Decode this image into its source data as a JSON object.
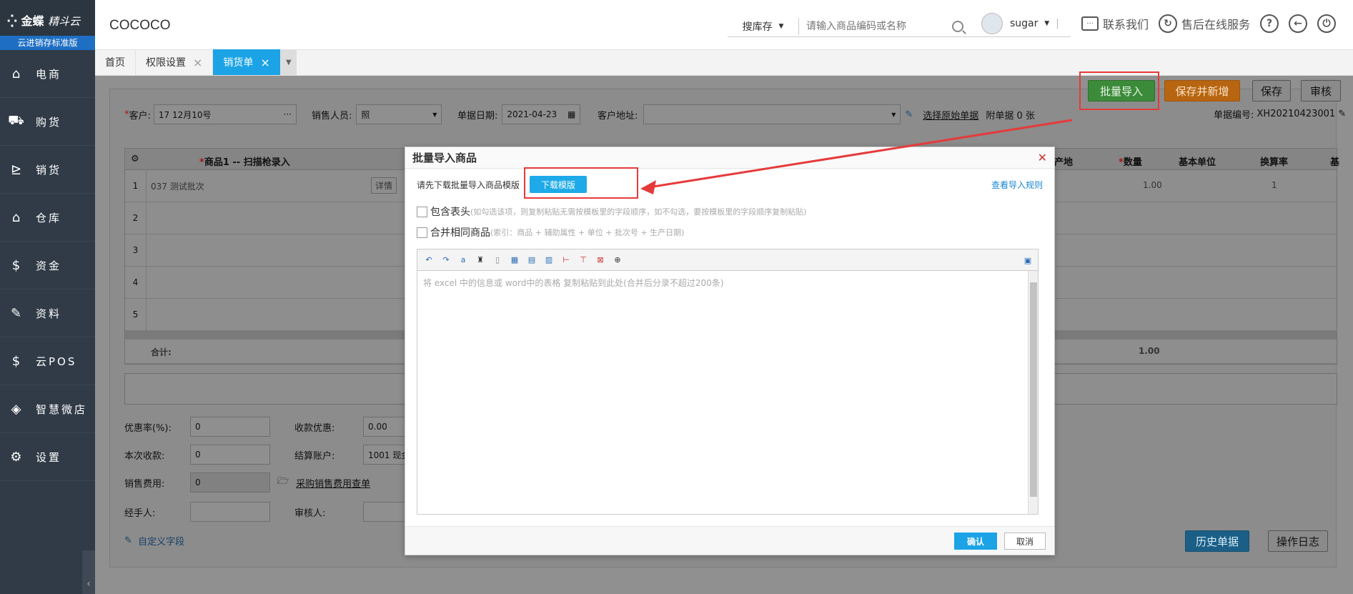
{
  "sidebar": {
    "brand": "金蝶",
    "brand_sub": "精斗云",
    "edition": "云进销存标准版",
    "items": [
      {
        "label": "电商",
        "icon": "store-icon"
      },
      {
        "label": "购货",
        "icon": "cart-icon"
      },
      {
        "label": "销货",
        "icon": "shipping-icon"
      },
      {
        "label": "仓库",
        "icon": "warehouse-icon"
      },
      {
        "label": "资金",
        "icon": "dollar-icon"
      },
      {
        "label": "资料",
        "icon": "pencil-icon"
      },
      {
        "label": "云POS",
        "icon": "pos-icon"
      },
      {
        "label": "智慧微店",
        "icon": "shop-icon"
      },
      {
        "label": "设置",
        "icon": "gear-icon"
      }
    ]
  },
  "topbar": {
    "company": "COCOCO",
    "search_scope": "搜库存",
    "search_placeholder": "请输入商品编码或名称",
    "username": "sugar",
    "contact": "联系我们",
    "service": "售后在线服务",
    "help": "?",
    "back": "←",
    "power": "⏻"
  },
  "tabs": [
    {
      "label": "首页",
      "closable": false
    },
    {
      "label": "权限设置",
      "closable": true
    },
    {
      "label": "销货单",
      "closable": true,
      "active": true
    }
  ],
  "toolbar": {
    "batch_import": "批量导入",
    "save_new": "保存并新增",
    "save": "保存",
    "audit": "审核"
  },
  "form": {
    "customer_label": "客户:",
    "customer_value": "17 12月10号",
    "sales_label": "销售人员:",
    "sales_value": "照",
    "date_label": "单据日期:",
    "date_value": "2021-04-23",
    "address_label": "客户地址:",
    "address_value": "",
    "select_original": "选择原始单据",
    "attach": "附单据 0 张",
    "docno_label": "单据编号:",
    "docno_value": "XH20210423001"
  },
  "grid": {
    "col_product": "商品1 -- 扫描枪录入",
    "col_origin": "产地",
    "col_qty": "数量",
    "col_unit": "基本单位",
    "col_rate": "换算率",
    "col_more": "基",
    "rows": [
      {
        "num": "1",
        "product": "037 测试批次",
        "detail": "详情",
        "qty": "1.00",
        "rate": "1"
      },
      {
        "num": "2"
      },
      {
        "num": "3"
      },
      {
        "num": "4"
      },
      {
        "num": "5"
      }
    ],
    "total_label": "合计:",
    "total_qty": "1.00"
  },
  "bottom_form": {
    "discount_rate_label": "优惠率(%):",
    "discount_rate_value": "0",
    "collect_discount_label": "收款优惠:",
    "collect_discount_value": "0.00",
    "this_collect_label": "本次收款:",
    "this_collect_value": "0",
    "settle_account_label": "结算账户:",
    "settle_account_value": "1001 现金",
    "sales_fee_label": "销售费用:",
    "sales_fee_value": "0",
    "purchase_fee_link": "采购销售费用查单",
    "handler_label": "经手人:",
    "reviewer_label": "审核人:",
    "custom_field": "自定义字段",
    "history": "历史单据",
    "oplog": "操作日志"
  },
  "modal": {
    "title": "批量导入商品",
    "download_hint": "请先下载批量导入商品模版",
    "download_btn": "下载模版",
    "rule_link": "查看导入规则",
    "opt1_label": "包含表头",
    "opt1_hint": "(如勾选该项，则复制粘贴无需按模板里的字段顺序，如不勾选，要按模板里的字段顺序复制粘贴)",
    "opt2_label": "合并相同商品",
    "opt2_hint": "(索引：商品 + 辅助属性 + 单位 + 批次号 + 生产日期)",
    "editor_placeholder": "将 excel 中的信息或 word中的表格 复制粘贴到此处(合并后分录不超过200条)",
    "ok": "确认",
    "cancel": "取消"
  },
  "colors": {
    "sidebar_bg": "#303b47",
    "accent": "#1ba3e6",
    "highlight": "#e63a3a"
  }
}
